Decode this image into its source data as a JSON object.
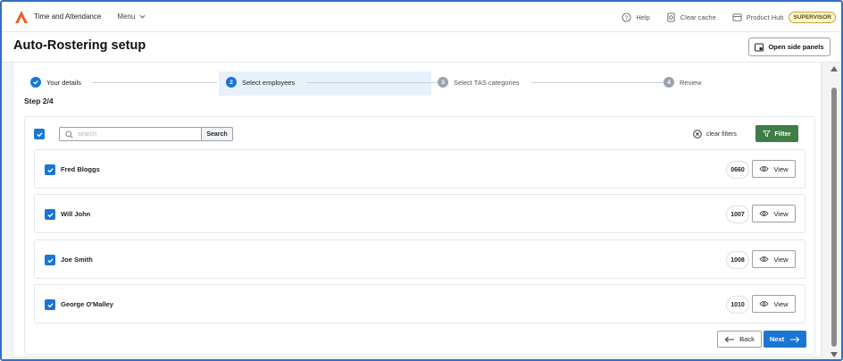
{
  "topbar": {
    "app_title": "Time and Attendance",
    "menu_label": "Menu",
    "help_label": "Help",
    "clear_cache_label": "Clear cache",
    "product_hub_label": "Product Hub",
    "role_badge": "SUPERVISOR"
  },
  "header": {
    "title": "Auto-Rostering setup",
    "side_panels_label": "Open side panels"
  },
  "stepper": {
    "steps": [
      {
        "number": "1",
        "label": "Your details",
        "state": "done"
      },
      {
        "number": "2",
        "label": "Select employees",
        "state": "active"
      },
      {
        "number": "3",
        "label": "Select TAS categories",
        "state": "todo"
      },
      {
        "number": "4",
        "label": "Review",
        "state": "todo"
      }
    ],
    "step_count": "Step 2/4"
  },
  "toolbar": {
    "search_placeholder": "search",
    "search_button": "Search",
    "clear_filters": "clear filters",
    "filter_button": "Filter"
  },
  "employees": [
    {
      "name": "Fred Bloggs",
      "code": "0660",
      "view_label": "View"
    },
    {
      "name": "Will John",
      "code": "1007",
      "view_label": "View"
    },
    {
      "name": "Joe Smith",
      "code": "1008",
      "view_label": "View"
    },
    {
      "name": "George O'Malley",
      "code": "1010",
      "view_label": "View"
    }
  ],
  "footer": {
    "back_label": "Back",
    "next_label": "Next"
  },
  "colors": {
    "accent_blue": "#1976d2",
    "filter_green": "#3e7d45",
    "logo_orange": "#e8612c"
  }
}
